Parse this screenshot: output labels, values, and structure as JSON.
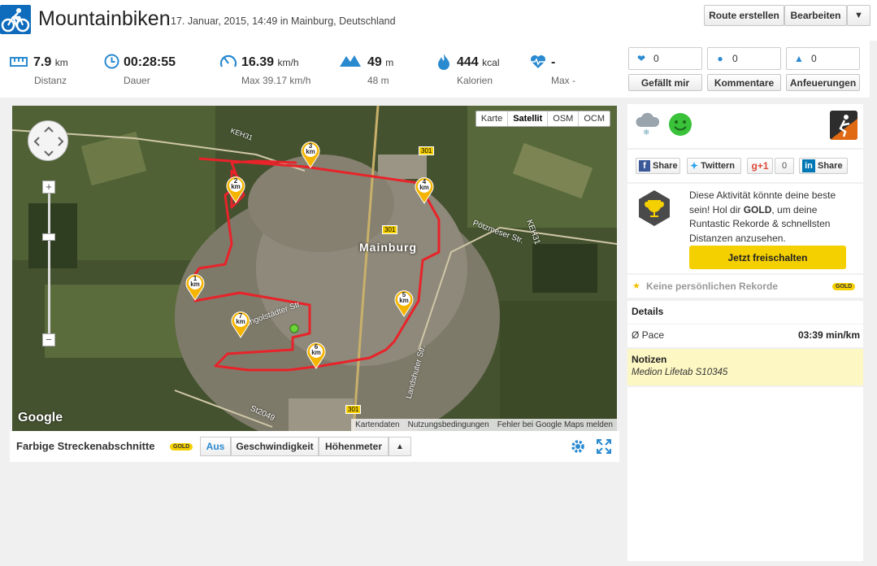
{
  "header": {
    "title": "Mountainbiken",
    "subtitle": "17. Januar, 2015, 14:49 in Mainburg, Deutschland",
    "route_btn": "Route erstellen",
    "edit_btn": "Bearbeiten",
    "dropdown_glyph": "▼"
  },
  "stats": {
    "distance": {
      "value": "7.9",
      "unit": "km",
      "label": "Distanz"
    },
    "duration": {
      "value": "00:28:55",
      "label": "Dauer"
    },
    "speed": {
      "value": "16.39",
      "unit": "km/h",
      "label": "Max 39.17 km/h"
    },
    "elevation": {
      "value": "49",
      "unit": "m",
      "label": "48 m"
    },
    "calories": {
      "value": "444",
      "unit": "kcal",
      "label": "Kalorien"
    },
    "heartrate": {
      "value": "-",
      "label": "Max -"
    }
  },
  "social": {
    "likes": {
      "count": "0",
      "label": "Gefällt mir"
    },
    "comments": {
      "count": "0",
      "label": "Kommentare"
    },
    "cheers": {
      "count": "0",
      "label": "Anfeuerungen"
    }
  },
  "map": {
    "types": [
      "Karte",
      "Satellit",
      "OSM",
      "OCM"
    ],
    "active_type": "Satellit",
    "footer": [
      "Kartendaten",
      "Nutzungsbedingungen",
      "Fehler bei Google Maps melden"
    ],
    "google_label": "Google",
    "town_label": "Mainburg",
    "road_labels": [
      "KEH31",
      "301",
      "301",
      "Pötzmeser Str.",
      "KEH31",
      "Landshuter Str.",
      "St2049",
      "Ingolstädter Str.",
      "301"
    ],
    "markers": [
      "1",
      "2",
      "3",
      "4",
      "5",
      "6",
      "7"
    ],
    "marker_unit": "km"
  },
  "segments": {
    "title": "Farbige Streckenabschnitte",
    "badge": "GOLD",
    "options": [
      "Aus",
      "Geschwindigkeit",
      "Höhenmeter"
    ],
    "active": "Aus",
    "up_glyph": "▲"
  },
  "share": {
    "facebook": "Share",
    "twitter": "Twittern",
    "gplus": "+1",
    "gplus_count": "0",
    "linkedin": "Share"
  },
  "gold_promo": {
    "text_before": "Diese Aktivität könnte deine beste sein! Hol dir ",
    "text_bold": "GOLD",
    "text_after": ", um deine Runtastic Rekorde & schnellsten Distanzen anzusehen.",
    "button": "Jetzt freischalten"
  },
  "records": {
    "label": "Keine persönlichen Rekorde",
    "badge": "GOLD"
  },
  "details": {
    "title": "Details",
    "pace_label": "Ø Pace",
    "pace_value": "03:39 min/km"
  },
  "notes": {
    "title": "Notizen",
    "text": "Medion Lifetab S10345"
  },
  "colors": {
    "accent": "#2a8ad0",
    "gold": "#f5d000",
    "route": "#e8232a",
    "notes_bg": "#fdf7c3"
  }
}
